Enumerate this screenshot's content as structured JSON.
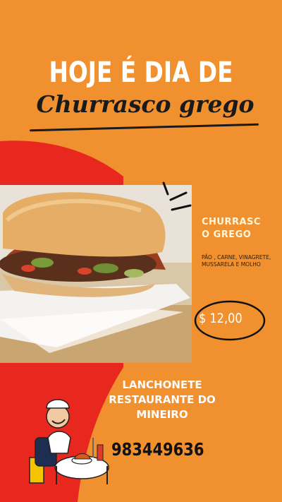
{
  "headline": "HOJE É DIA DE",
  "subheadline": "Churrasco grego",
  "product": {
    "name": "CHURRASC\nO GREGO",
    "description": "PÃO , CARNE, VINAGRETE, MUSSARELA E MOLHO",
    "price": "$ 12,00"
  },
  "restaurant": "LANCHONETE RESTAURANTE DO MINEIRO",
  "phone": "983449636",
  "colors": {
    "background": "#f0902e",
    "swoosh": "#e8271e",
    "text_light": "#ffffff",
    "text_dark": "#1a1a1a"
  },
  "icons": [
    "chef-illustration",
    "sparkle-lines-icon"
  ]
}
